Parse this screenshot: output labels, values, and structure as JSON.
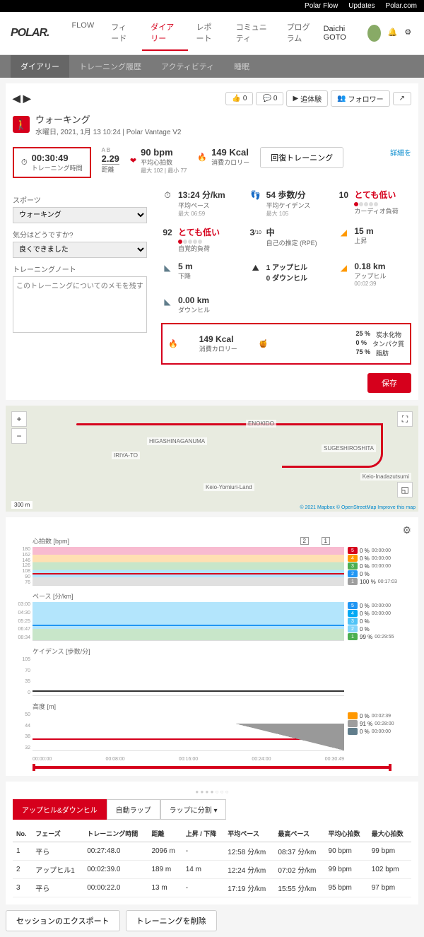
{
  "topbar": {
    "flow": "Polar Flow",
    "updates": "Updates",
    "polar": "Polar.com"
  },
  "nav": {
    "logo": "POLAR.",
    "items": [
      "FLOW",
      "フィード",
      "ダイアリー",
      "レポート",
      "コミュニティ",
      "プログラム"
    ],
    "user": "Daichi GOTO"
  },
  "subnav": [
    "ダイアリー",
    "トレーニング履歴",
    "アクティビティ",
    "睡眠"
  ],
  "header": {
    "title": "ウォーキング",
    "date": "水曜日, 2021, 1月 13 10:24 | Polar Vantage V2",
    "like": "0",
    "comment": "0",
    "exp": "追体験",
    "follow": "フォロワー"
  },
  "stats": {
    "duration": {
      "v": "00:30:49",
      "l": "トレーニング時間"
    },
    "distance": {
      "ab": "A B",
      "v": "2.29",
      "l": "距離"
    },
    "hr": {
      "v": "90 bpm",
      "l": "平均心拍数",
      "s": "最大 102 | 最小 77"
    },
    "cal": {
      "v": "149 Kcal",
      "l": "消費カロリー"
    },
    "recovery": "回復トレーニング",
    "detail": "詳細を"
  },
  "left": {
    "sport_l": "スポーツ",
    "sport_v": "ウォーキング",
    "feel_l": "気分はどうですか?",
    "feel_v": "良くできました",
    "note_l": "トレーニングノート",
    "note_ph": "このトレーニングについてのメモを残す"
  },
  "metrics": {
    "pace": {
      "v": "13:24 分/km",
      "l": "平均ペース",
      "s": "最大 06:59"
    },
    "cadence": {
      "v": "54 歩数/分",
      "l": "平均ケイデンス",
      "s": "最大 105"
    },
    "load": {
      "n": "10",
      "v": "とても低い",
      "l": "カーディオ負荷"
    },
    "rpe_low": {
      "n": "92",
      "v": "とても低い",
      "l": "自覚的負荷"
    },
    "rpe_mid": {
      "n": "3",
      "d": "/10",
      "v": "中",
      "l": "自己の推定 (RPE)"
    },
    "asc": {
      "v": "15 m",
      "l": "上昇"
    },
    "desc": {
      "v": "5 m",
      "l": "下降"
    },
    "hills": {
      "v1": "1 アップヒル",
      "v2": "0 ダウンヒル"
    },
    "uphill": {
      "v": "0.18 km",
      "l": "アップヒル",
      "s": "00:02:39"
    },
    "downhill": {
      "v": "0.00 km",
      "l": "ダウンヒル"
    },
    "macro": {
      "v": "149 Kcal",
      "l": "消費カロリー",
      "carb": "25 %",
      "carb_l": "炭水化物",
      "prot": "0 %",
      "prot_l": "タンパク質",
      "fat": "75 %",
      "fat_l": "脂肪"
    }
  },
  "save": "保存",
  "map": {
    "scale": "300 m",
    "attr": "© 2021 Mapbox © OpenStreetMap Improve this map",
    "places": [
      "ENOKIDO",
      "HIGASHINAGANUMA",
      "IRIYA-TO",
      "SUGESHIROSHITA",
      "Keio-Inadazutsumi",
      "Keio-Yomiuri-Land"
    ]
  },
  "chart_data": [
    {
      "type": "line",
      "title": "心拍数 [bpm]",
      "ylim": [
        76,
        180
      ],
      "yticks": [
        180,
        162,
        146,
        126,
        108,
        90,
        76
      ],
      "zones": [
        {
          "z": "5",
          "pct": "0 %",
          "t": "00:00:00",
          "c": "#d6001c"
        },
        {
          "z": "4",
          "pct": "0 %",
          "t": "00:00:00",
          "c": "#ff9800"
        },
        {
          "z": "3",
          "pct": "0 %",
          "t": "00:00:00",
          "c": "#4caf50"
        },
        {
          "z": "2",
          "pct": "0 %",
          "t": "",
          "c": "#2196f3"
        },
        {
          "z": "1",
          "pct": "100 %",
          "t": "00:17:03",
          "c": "#9e9e9e"
        }
      ],
      "markers": [
        "1",
        "2"
      ]
    },
    {
      "type": "line",
      "title": "ペース [分/km]",
      "ylim": [
        "08:34",
        "03:00"
      ],
      "yticks": [
        "03:00",
        "04:30",
        "05:25",
        "06:47",
        "08:34"
      ],
      "zones": [
        {
          "z": "5",
          "pct": "0 %",
          "t": "00:00:00",
          "c": "#2196f3"
        },
        {
          "z": "4",
          "pct": "0 %",
          "t": "00:00:00",
          "c": "#03a9f4"
        },
        {
          "z": "3",
          "pct": "0 %",
          "t": "",
          "c": "#4fc3f7"
        },
        {
          "z": "2",
          "pct": "0 %",
          "t": "",
          "c": "#81d4fa"
        },
        {
          "z": "1",
          "pct": "99 %",
          "t": "00:29:55",
          "c": "#4caf50"
        }
      ]
    },
    {
      "type": "line",
      "title": "ケイデンス [歩数/分]",
      "ylim": [
        0,
        105
      ],
      "yticks": [
        105,
        70,
        35,
        0
      ]
    },
    {
      "type": "area",
      "title": "高度 [m]",
      "ylim": [
        32,
        50
      ],
      "yticks": [
        50.0,
        44.0,
        38.0,
        32.0
      ],
      "zones": [
        {
          "z": "",
          "pct": "0 %",
          "t": "00:02:39",
          "c": "#ff9800"
        },
        {
          "z": "",
          "pct": "91 %",
          "t": "00:28:00",
          "c": "#9e9e9e"
        },
        {
          "z": "",
          "pct": "0 %",
          "t": "00:00:00",
          "c": "#607d8b"
        }
      ]
    }
  ],
  "x_axis": [
    "00:00:00",
    "00:08:00",
    "00:16:00",
    "00:24:00",
    "00:30:49"
  ],
  "tabs": {
    "active": "アップヒル&ダウンヒル",
    "t2": "自動ラップ",
    "t3": "ラップに分割 ▾"
  },
  "table": {
    "headers": [
      "No.",
      "フェーズ",
      "トレーニング時間",
      "距離",
      "上昇 / 下降",
      "平均ペース",
      "最高ペース",
      "平均心拍数",
      "最大心拍数"
    ],
    "rows": [
      [
        "1",
        "平ら",
        "00:27:48.0",
        "2096 m",
        "-",
        "12:58 分/km",
        "08:37 分/km",
        "90 bpm",
        "99 bpm"
      ],
      [
        "2",
        "アップヒル1",
        "00:02:39.0",
        "189 m",
        "14 m",
        "12:24 分/km",
        "07:02 分/km",
        "99 bpm",
        "102 bpm"
      ],
      [
        "3",
        "平ら",
        "00:00:22.0",
        "13 m",
        "-",
        "17:19 分/km",
        "15:55 分/km",
        "95 bpm",
        "97 bpm"
      ]
    ]
  },
  "bottom": {
    "export": "セッションのエクスポート",
    "delete": "トレーニングを削除"
  }
}
